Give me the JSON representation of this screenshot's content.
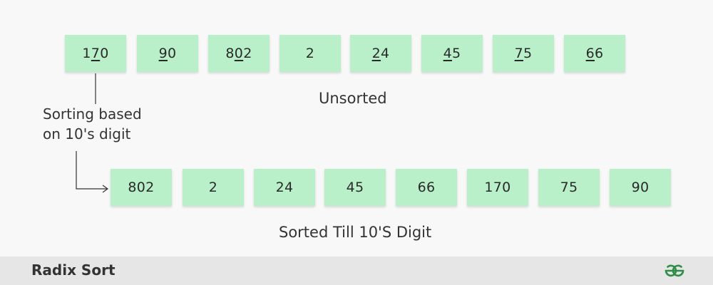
{
  "unsorted": {
    "caption": "Unsorted",
    "items": [
      {
        "pre": "1",
        "digit": "7",
        "post": "0"
      },
      {
        "pre": "",
        "digit": "9",
        "post": "0"
      },
      {
        "pre": "8",
        "digit": "0",
        "post": "2"
      },
      {
        "pre": "",
        "digit": "",
        "post": "2"
      },
      {
        "pre": "",
        "digit": "2",
        "post": "4"
      },
      {
        "pre": "",
        "digit": "4",
        "post": "5"
      },
      {
        "pre": "",
        "digit": "7",
        "post": "5"
      },
      {
        "pre": "",
        "digit": "6",
        "post": "6"
      }
    ]
  },
  "note": {
    "line1": "Sorting based",
    "line2": "on 10's digit"
  },
  "sorted": {
    "caption": "Sorted Till 10'S Digit",
    "items": [
      "802",
      "2",
      "24",
      "45",
      "66",
      "170",
      "75",
      "90"
    ]
  },
  "footer": {
    "title": "Radix Sort",
    "logo_icon": "gfg-logo-icon",
    "logo_color": "#2f8d46"
  },
  "colors": {
    "cell_fill": "#b9f0ca",
    "footer_bg": "#e6e6e6",
    "background": "#f8f8f8"
  }
}
